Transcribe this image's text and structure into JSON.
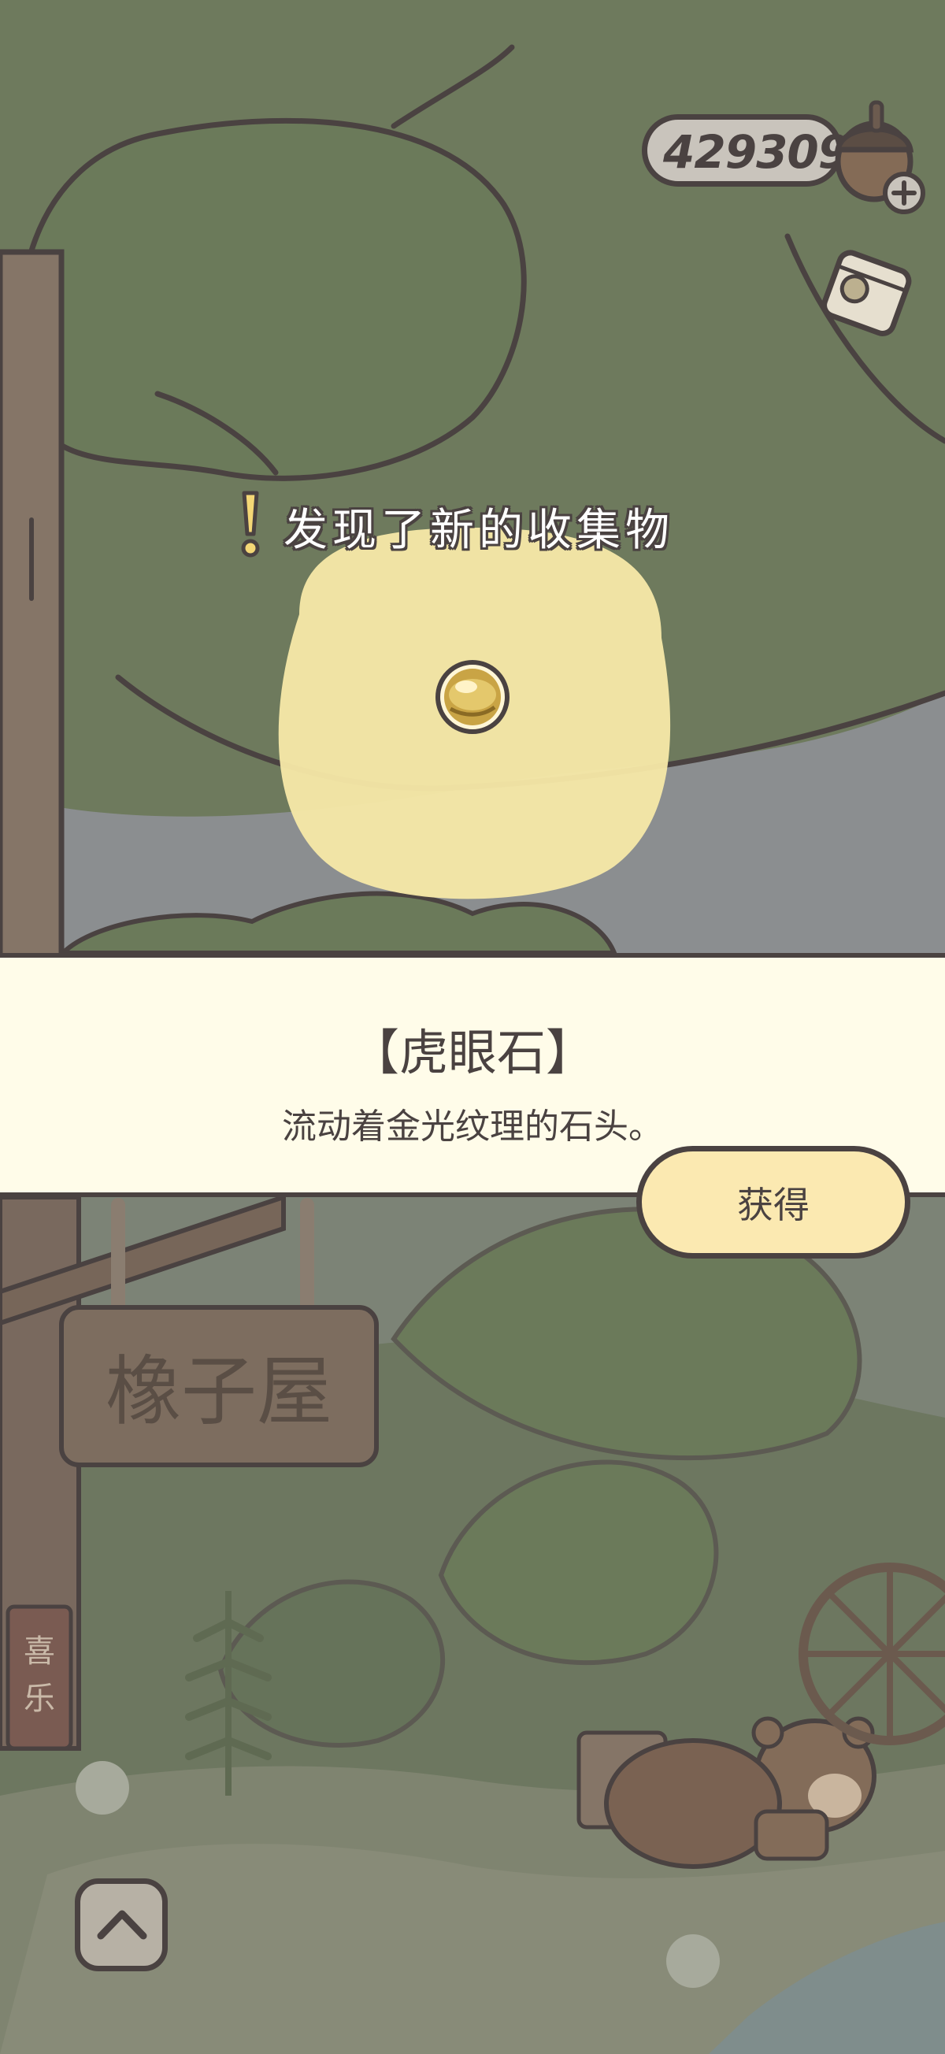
{
  "hud": {
    "acorn_count": "429309",
    "icons": [
      "acorn-icon",
      "plus-icon",
      "ticket-icon"
    ]
  },
  "discovery": {
    "header": "发现了新的收集物",
    "icon": "exclamation-icon"
  },
  "item": {
    "name": "【虎眼石】",
    "description": "流动着金光纹理的石头。",
    "icon": "tiger-eye-stone-icon"
  },
  "actions": {
    "obtain_label": "获得",
    "collapse_icon": "chevron-up-icon"
  },
  "scene": {
    "sign_text": "橡子屋",
    "banner_text": "喜乐"
  },
  "colors": {
    "outline": "#4a4241",
    "panel_bg": "#fffce9",
    "button_bg": "#fbe9b1",
    "glow": "#f7e9a8",
    "foliage": "#6e7a5d",
    "sky": "#8c8f91"
  }
}
